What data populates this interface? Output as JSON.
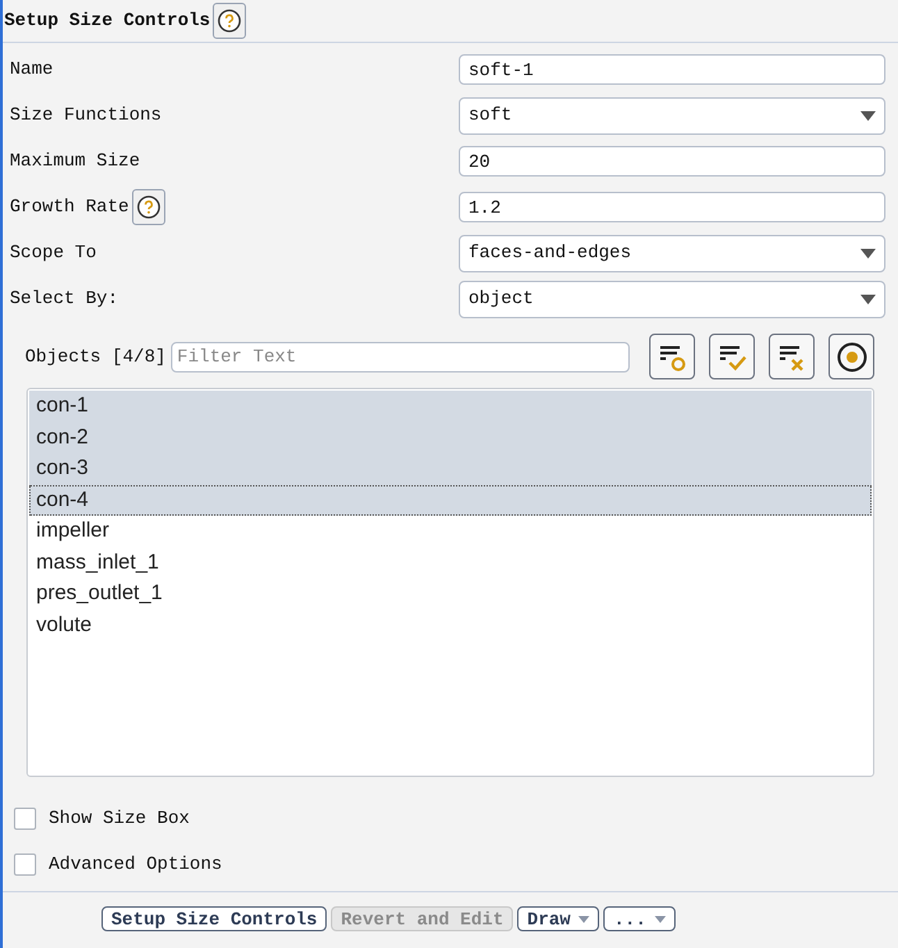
{
  "title": "Setup Size Controls",
  "fields": [
    {
      "label": "Name",
      "kind": "text",
      "value": "soft-1",
      "help": false
    },
    {
      "label": "Size Functions",
      "kind": "dropdown",
      "value": "soft",
      "help": false
    },
    {
      "label": "Maximum Size",
      "kind": "text",
      "value": "20",
      "help": false
    },
    {
      "label": "Growth Rate",
      "kind": "text",
      "value": "1.2",
      "help": true
    },
    {
      "label": "Scope To",
      "kind": "dropdown",
      "value": "faces-and-edges",
      "help": false
    },
    {
      "label": "Select By:",
      "kind": "dropdown",
      "value": "object",
      "help": false
    }
  ],
  "objects": {
    "label": "Objects [4/8]",
    "filter": {
      "placeholder": "Filter Text"
    },
    "items": [
      {
        "text": "con-1",
        "selected": true,
        "focused": false
      },
      {
        "text": "con-2",
        "selected": true,
        "focused": false
      },
      {
        "text": "con-3",
        "selected": true,
        "focused": false
      },
      {
        "text": "con-4",
        "selected": true,
        "focused": true
      },
      {
        "text": "impeller",
        "selected": false,
        "focused": false
      },
      {
        "text": "mass_inlet_1",
        "selected": false,
        "focused": false
      },
      {
        "text": "pres_outlet_1",
        "selected": false,
        "focused": false
      },
      {
        "text": "volute",
        "selected": false,
        "focused": false
      }
    ]
  },
  "options": [
    {
      "label": "Show Size Box",
      "checked": false
    },
    {
      "label": "Advanced Options",
      "checked": false
    }
  ],
  "buttons": [
    {
      "label": "Setup Size Controls",
      "disabled": false,
      "dropdown": false
    },
    {
      "label": "Revert and Edit",
      "disabled": true,
      "dropdown": false
    },
    {
      "label": "Draw",
      "disabled": false,
      "dropdown": true
    },
    {
      "label": "...",
      "disabled": false,
      "dropdown": true
    }
  ]
}
